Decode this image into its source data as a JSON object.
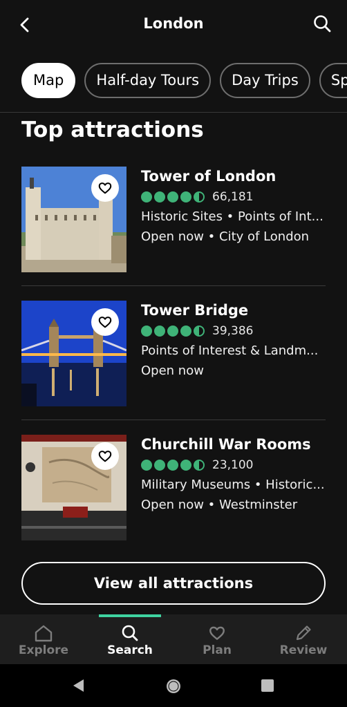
{
  "header": {
    "title": "London",
    "back_icon": "arrow-back-icon",
    "search_icon": "search-icon"
  },
  "chips": [
    "Map",
    "Half-day Tours",
    "Day Trips",
    "Sports"
  ],
  "section_title": "Top attractions",
  "attractions": [
    {
      "name": "Tower of London",
      "rating": 4.5,
      "reviews": "66,181",
      "categories": "Historic Sites • Points of Int...",
      "status": "Open now • City of London"
    },
    {
      "name": "Tower Bridge",
      "rating": 4.5,
      "reviews": "39,386",
      "categories": "Points of Interest & Landm...",
      "status": "Open now"
    },
    {
      "name": "Churchill War Rooms",
      "rating": 4.5,
      "reviews": "23,100",
      "categories": "Military Museums • Historic...",
      "status": "Open now • Westminster"
    }
  ],
  "view_all_label": "View all attractions",
  "bottom_nav": [
    {
      "label": "Explore",
      "icon": "home-icon",
      "active": false
    },
    {
      "label": "Search",
      "icon": "search-icon",
      "active": true
    },
    {
      "label": "Plan",
      "icon": "heart-icon",
      "active": false
    },
    {
      "label": "Review",
      "icon": "pencil-icon",
      "active": false
    }
  ],
  "colors": {
    "background": "#121212",
    "rating_green": "#3fb378",
    "nav_indicator": "#3fd3a0"
  }
}
